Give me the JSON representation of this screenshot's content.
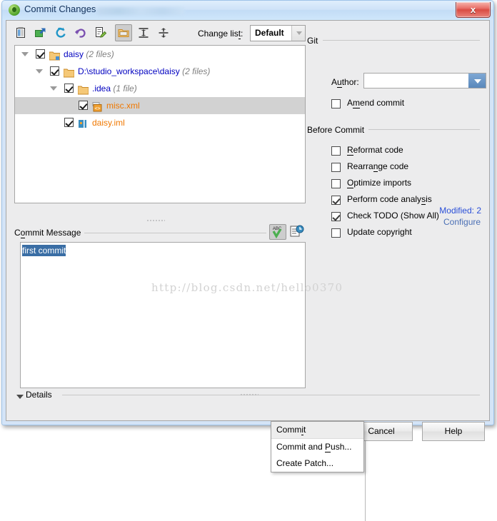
{
  "window": {
    "title": "Commit Changes",
    "app_icon": "intellij-idea-icon",
    "close_label": "x"
  },
  "toolbar": {
    "buttons": [
      {
        "name": "show-diff-icon",
        "title": "Show Diff"
      },
      {
        "name": "move-to-changelist-icon",
        "title": "Move to Another Changelist"
      },
      {
        "name": "refresh-icon",
        "title": "Refresh"
      },
      {
        "name": "revert-icon",
        "title": "Revert"
      },
      {
        "name": "edit-source-icon",
        "title": "Edit Source"
      },
      {
        "name": "group-by-directory-icon",
        "title": "Group by Directory",
        "pressed": true
      },
      {
        "name": "expand-all-icon",
        "title": "Expand All"
      },
      {
        "name": "collapse-all-icon",
        "title": "Collapse All"
      }
    ],
    "changelist_label": "Change lis",
    "changelist_label_mnemonic": "t",
    "changelist_label_suffix": ":",
    "changelist_value": "Default"
  },
  "tree": {
    "rows": [
      {
        "indent": 0,
        "twisty": true,
        "checked": true,
        "icon": "module-folder-icon",
        "label": "daisy",
        "label_color": "blue",
        "count": "(2 files)"
      },
      {
        "indent": 1,
        "twisty": true,
        "checked": true,
        "icon": "folder-icon",
        "label": "D:\\studio_workspace\\daisy",
        "label_color": "blue",
        "count": "(2 files)"
      },
      {
        "indent": 2,
        "twisty": true,
        "checked": true,
        "icon": "folder-icon",
        "label": ".idea",
        "label_color": "blue",
        "count": "(1 file)"
      },
      {
        "indent": 3,
        "twisty": false,
        "checked": true,
        "icon": "xml-file-icon",
        "label": "misc.xml",
        "label_color": "orange",
        "count": "",
        "selected": true
      },
      {
        "indent": 2,
        "twisty": false,
        "checked": true,
        "icon": "iml-file-icon",
        "label": "daisy.iml",
        "label_color": "orange",
        "count": ""
      }
    ],
    "modified_count": "Modified: 2"
  },
  "commit_message": {
    "label": "C",
    "label_mnemonic": "o",
    "label_rest": "mmit Message",
    "value": "first commit",
    "spellcheck_icon": "spellcheck-abc-icon",
    "history_icon": "message-history-icon"
  },
  "watermark": {
    "text": "http://blog.csdn.net/hello0370"
  },
  "details": {
    "label": "Details",
    "expander_icon": "triangle-down-icon"
  },
  "right_pane": {
    "git_group": "Git",
    "author_label_pre": "A",
    "author_label_mnemonic": "u",
    "author_label_rest": "thor:",
    "author_value": "",
    "amend": {
      "label_pre": "A",
      "label_mnemonic": "m",
      "label_rest": "end commit",
      "checked": false
    },
    "before_commit_group": "Before Commit",
    "before_commit_items": [
      {
        "pre": "",
        "mnemonic": "R",
        "rest": "eformat code",
        "checked": false
      },
      {
        "pre": "Rearra",
        "mnemonic": "n",
        "rest": "ge code",
        "checked": false
      },
      {
        "pre": "",
        "mnemonic": "O",
        "rest": "ptimize imports",
        "checked": false
      },
      {
        "pre": "Perform code analy",
        "mnemonic": "s",
        "rest": "is",
        "checked": true
      },
      {
        "pre": "Check TODO (Show All)",
        "mnemonic": "",
        "rest": "",
        "checked": true
      },
      {
        "pre": "Update copyright",
        "mnemonic": "",
        "rest": "",
        "checked": false
      }
    ],
    "configure_link": "Configure"
  },
  "buttons": {
    "commit_pre": "Comm",
    "commit_mnemonic": "i",
    "commit_rest": "t",
    "cancel": "Cancel",
    "help": "Help"
  },
  "menu": {
    "items": [
      {
        "pre": "Comm",
        "mnemonic": "i",
        "rest": "t",
        "highlighted": true
      },
      {
        "pre": "Commit and ",
        "mnemonic": "P",
        "rest": "ush...",
        "highlighted": false
      },
      {
        "pre": "Create Patch...",
        "mnemonic": "",
        "rest": "",
        "highlighted": false
      }
    ]
  },
  "colors": {
    "accent": "#3a6dc4",
    "modified_text": "#f07800",
    "link": "#4a6fb5",
    "selection": "#3a6ea5"
  }
}
